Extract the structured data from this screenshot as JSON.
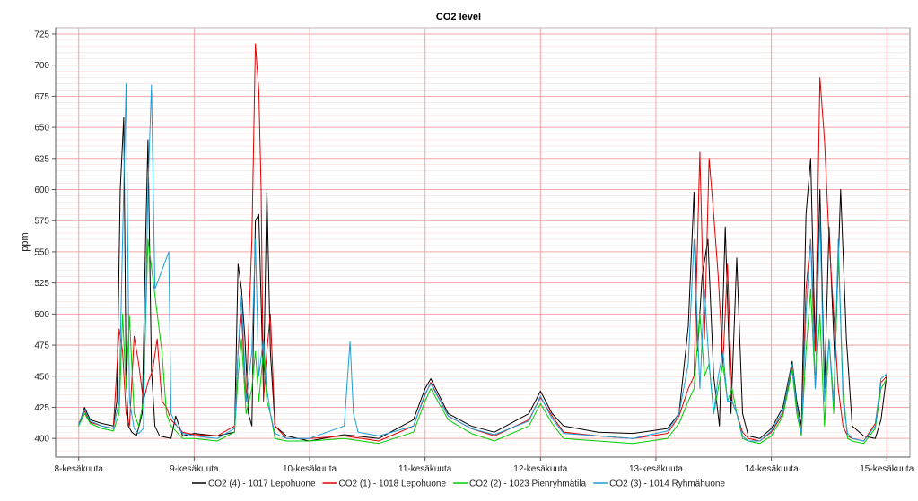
{
  "chart_data": {
    "type": "line",
    "title": "CO2 level",
    "ylabel": "ppm",
    "xlabel": "",
    "ylim": [
      385,
      730
    ],
    "xlim": [
      -0.2,
      7.2
    ],
    "y_ticks": [
      400,
      425,
      450,
      475,
      500,
      525,
      550,
      575,
      600,
      625,
      650,
      675,
      700,
      725
    ],
    "x_ticks": [
      {
        "x": 0,
        "label": "8-kesäkuuta"
      },
      {
        "x": 1,
        "label": "9-kesäkuuta"
      },
      {
        "x": 2,
        "label": "10-kesäkuuta"
      },
      {
        "x": 3,
        "label": "11-kesäkuuta"
      },
      {
        "x": 4,
        "label": "12-kesäkuuta"
      },
      {
        "x": 5,
        "label": "13-kesäkuuta"
      },
      {
        "x": 6,
        "label": "14-kesäkuuta"
      },
      {
        "x": 7,
        "label": "15-kesäkuuta"
      }
    ],
    "x_unit": "day (8-kesäkuuta = 0)",
    "grid": true,
    "legend_position": "bottom",
    "series": [
      {
        "name": "CO2  (4) - 1017 Lepohuone",
        "color": "#000000",
        "x": [
          0,
          0.05,
          0.1,
          0.2,
          0.3,
          0.33,
          0.36,
          0.39,
          0.41,
          0.43,
          0.46,
          0.5,
          0.55,
          0.58,
          0.6,
          0.63,
          0.66,
          0.7,
          0.8,
          0.84,
          0.9,
          1.0,
          1.2,
          1.35,
          1.38,
          1.41,
          1.44,
          1.47,
          1.5,
          1.53,
          1.56,
          1.6,
          1.63,
          1.66,
          1.7,
          1.8,
          2.0,
          2.3,
          2.6,
          2.9,
          3.0,
          3.05,
          3.2,
          3.4,
          3.6,
          3.9,
          4.0,
          4.1,
          4.2,
          4.5,
          4.8,
          5.1,
          5.2,
          5.28,
          5.33,
          5.36,
          5.4,
          5.45,
          5.5,
          5.55,
          5.6,
          5.65,
          5.7,
          5.75,
          5.8,
          5.9,
          6.0,
          6.1,
          6.18,
          6.22,
          6.26,
          6.3,
          6.34,
          6.38,
          6.42,
          6.46,
          6.5,
          6.55,
          6.6,
          6.65,
          6.7,
          6.8,
          6.9,
          6.95,
          7.0
        ],
        "y": [
          410,
          425,
          415,
          412,
          410,
          430,
          600,
          658,
          450,
          410,
          405,
          402,
          420,
          560,
          640,
          455,
          410,
          402,
          400,
          418,
          402,
          404,
          402,
          405,
          540,
          520,
          480,
          420,
          410,
          575,
          580,
          440,
          600,
          470,
          410,
          402,
          398,
          403,
          400,
          415,
          440,
          448,
          420,
          410,
          405,
          420,
          438,
          420,
          410,
          405,
          404,
          408,
          420,
          490,
          598,
          470,
          530,
          560,
          450,
          410,
          570,
          420,
          545,
          420,
          402,
          400,
          408,
          425,
          462,
          430,
          410,
          580,
          625,
          470,
          600,
          440,
          570,
          460,
          600,
          480,
          410,
          402,
          400,
          415,
          452
        ]
      },
      {
        "name": "CO2 (1) - 1018 Lepohuone",
        "color": "#e00000",
        "x": [
          0,
          0.05,
          0.1,
          0.2,
          0.3,
          0.35,
          0.38,
          0.41,
          0.44,
          0.48,
          0.52,
          0.56,
          0.6,
          0.64,
          0.68,
          0.72,
          0.76,
          0.8,
          0.85,
          0.9,
          1.0,
          1.2,
          1.35,
          1.38,
          1.41,
          1.45,
          1.5,
          1.53,
          1.56,
          1.58,
          1.6,
          1.63,
          1.66,
          1.7,
          1.8,
          2.0,
          2.3,
          2.6,
          2.9,
          3.0,
          3.05,
          3.2,
          3.4,
          3.6,
          3.9,
          4.0,
          4.1,
          4.2,
          4.5,
          4.8,
          5.1,
          5.2,
          5.28,
          5.33,
          5.38,
          5.42,
          5.46,
          5.5,
          5.54,
          5.58,
          5.62,
          5.66,
          5.7,
          5.75,
          5.8,
          5.9,
          6.0,
          6.1,
          6.18,
          6.22,
          6.26,
          6.3,
          6.34,
          6.38,
          6.42,
          6.46,
          6.5,
          6.54,
          6.58,
          6.62,
          6.66,
          6.7,
          6.8,
          6.9,
          6.95,
          7.0
        ],
        "y": [
          412,
          422,
          413,
          410,
          408,
          488,
          470,
          420,
          410,
          482,
          460,
          430,
          445,
          455,
          480,
          430,
          425,
          415,
          410,
          405,
          403,
          402,
          410,
          470,
          500,
          430,
          560,
          717,
          680,
          600,
          430,
          470,
          500,
          410,
          400,
          400,
          402,
          398,
          410,
          435,
          445,
          418,
          408,
          402,
          415,
          433,
          418,
          405,
          402,
          400,
          404,
          418,
          440,
          450,
          630,
          480,
          625,
          580,
          530,
          460,
          540,
          430,
          420,
          405,
          400,
          398,
          405,
          420,
          458,
          425,
          405,
          520,
          560,
          470,
          690,
          640,
          560,
          500,
          440,
          410,
          402,
          400,
          398,
          412,
          445,
          450
        ]
      },
      {
        "name": "CO2 (2) - 1023 Pienryhmätila",
        "color": "#00cc00",
        "x": [
          0,
          0.05,
          0.1,
          0.2,
          0.3,
          0.35,
          0.38,
          0.41,
          0.44,
          0.48,
          0.52,
          0.56,
          0.6,
          0.64,
          0.68,
          0.72,
          0.76,
          0.8,
          0.85,
          0.9,
          1.0,
          1.2,
          1.35,
          1.38,
          1.41,
          1.45,
          1.5,
          1.53,
          1.56,
          1.6,
          1.63,
          1.66,
          1.7,
          1.8,
          2.0,
          2.3,
          2.6,
          2.9,
          3.0,
          3.05,
          3.2,
          3.4,
          3.6,
          3.9,
          4.0,
          4.1,
          4.2,
          4.5,
          4.8,
          5.1,
          5.2,
          5.28,
          5.33,
          5.38,
          5.42,
          5.46,
          5.5,
          5.54,
          5.58,
          5.62,
          5.66,
          5.7,
          5.75,
          5.8,
          5.9,
          6.0,
          6.1,
          6.18,
          6.22,
          6.26,
          6.3,
          6.34,
          6.38,
          6.42,
          6.46,
          6.5,
          6.54,
          6.58,
          6.62,
          6.66,
          6.7,
          6.8,
          6.9,
          6.95,
          7.0
        ],
        "y": [
          410,
          420,
          412,
          408,
          406,
          420,
          500,
          440,
          498,
          420,
          410,
          430,
          560,
          530,
          500,
          470,
          420,
          410,
          405,
          400,
          400,
          398,
          405,
          450,
          480,
          420,
          440,
          470,
          430,
          470,
          430,
          420,
          400,
          398,
          398,
          400,
          396,
          405,
          430,
          440,
          415,
          404,
          398,
          410,
          428,
          412,
          400,
          398,
          396,
          400,
          412,
          430,
          440,
          500,
          450,
          460,
          420,
          440,
          460,
          430,
          440,
          420,
          400,
          398,
          396,
          402,
          418,
          455,
          420,
          402,
          470,
          520,
          440,
          500,
          410,
          480,
          420,
          550,
          440,
          400,
          398,
          396,
          408,
          440,
          448
        ]
      },
      {
        "name": "CO2 (3) - 1014 Ryhmähuone",
        "color": "#1a9fd9",
        "x": [
          0,
          0.05,
          0.1,
          0.2,
          0.3,
          0.35,
          0.38,
          0.41,
          0.44,
          0.48,
          0.52,
          0.56,
          0.6,
          0.63,
          0.66,
          0.7,
          0.78,
          0.8,
          0.85,
          0.9,
          1.0,
          1.2,
          1.35,
          1.38,
          1.41,
          1.45,
          1.5,
          1.53,
          1.56,
          1.6,
          1.63,
          1.66,
          1.7,
          1.8,
          2.0,
          2.3,
          2.35,
          2.38,
          2.42,
          2.6,
          2.9,
          3.0,
          3.05,
          3.2,
          3.4,
          3.6,
          3.9,
          4.0,
          4.1,
          4.2,
          4.5,
          4.8,
          5.1,
          5.2,
          5.28,
          5.33,
          5.38,
          5.42,
          5.46,
          5.5,
          5.54,
          5.58,
          5.62,
          5.66,
          5.7,
          5.75,
          5.8,
          5.9,
          6.0,
          6.1,
          6.18,
          6.22,
          6.26,
          6.3,
          6.34,
          6.38,
          6.42,
          6.46,
          6.5,
          6.54,
          6.58,
          6.62,
          6.66,
          6.7,
          6.8,
          6.9,
          6.95,
          7.0
        ],
        "y": [
          411,
          423,
          414,
          410,
          408,
          430,
          560,
          685,
          430,
          408,
          404,
          408,
          600,
          684,
          520,
          530,
          550,
          420,
          410,
          404,
          402,
          400,
          408,
          470,
          515,
          430,
          470,
          560,
          450,
          480,
          440,
          420,
          404,
          400,
          400,
          410,
          478,
          420,
          405,
          402,
          410,
          436,
          444,
          418,
          408,
          403,
          414,
          434,
          416,
          404,
          402,
          400,
          406,
          420,
          460,
          560,
          440,
          520,
          460,
          420,
          450,
          470,
          430,
          430,
          420,
          402,
          398,
          398,
          406,
          422,
          460,
          426,
          404,
          500,
          560,
          440,
          580,
          430,
          480,
          430,
          560,
          430,
          404,
          400,
          398,
          410,
          448,
          452
        ]
      }
    ]
  }
}
